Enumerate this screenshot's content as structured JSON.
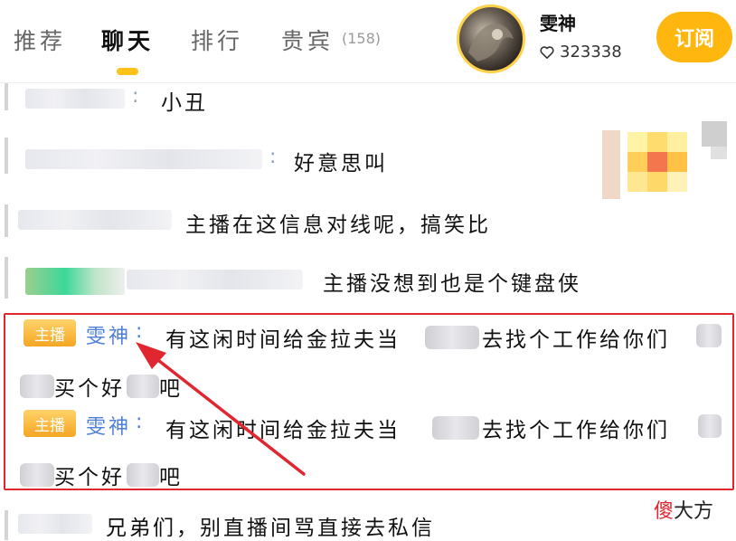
{
  "tabs": [
    {
      "label": "推荐",
      "active": false
    },
    {
      "label": "聊天",
      "active": true
    },
    {
      "label": "排行",
      "active": false
    },
    {
      "label": "贵宾",
      "active": false,
      "count": "(158)"
    }
  ],
  "anchor": {
    "name": "雯神",
    "fans": "323338",
    "subscribe_label": "订阅"
  },
  "chat": [
    {
      "message": "小丑"
    },
    {
      "message": "好意思叫"
    },
    {
      "message": "主播在这信息对线呢，搞笑比"
    },
    {
      "message": "主播没想到也是个键盘侠"
    }
  ],
  "highlighted": [
    {
      "badge": "主播",
      "name": "雯神",
      "colon": ":",
      "part1": "有这闲时间给金拉夫当",
      "part2": "去找个工作给你们",
      "part3": "买个好",
      "part4": "吧"
    },
    {
      "badge": "主播",
      "name": "雯神",
      "colon": ":",
      "part1": "有这闲时间给金拉夫当",
      "part2": "去找个工作给你们",
      "part3": "买个好",
      "part4": "吧"
    }
  ],
  "last_message": "兄弟们，别直播间骂直接去私信",
  "watermark": {
    "red": "傻",
    "black": "大方"
  },
  "colors": {
    "accent": "#ffb70f",
    "highlight_border": "#e0262f",
    "host_name": "#4e7fd6"
  }
}
